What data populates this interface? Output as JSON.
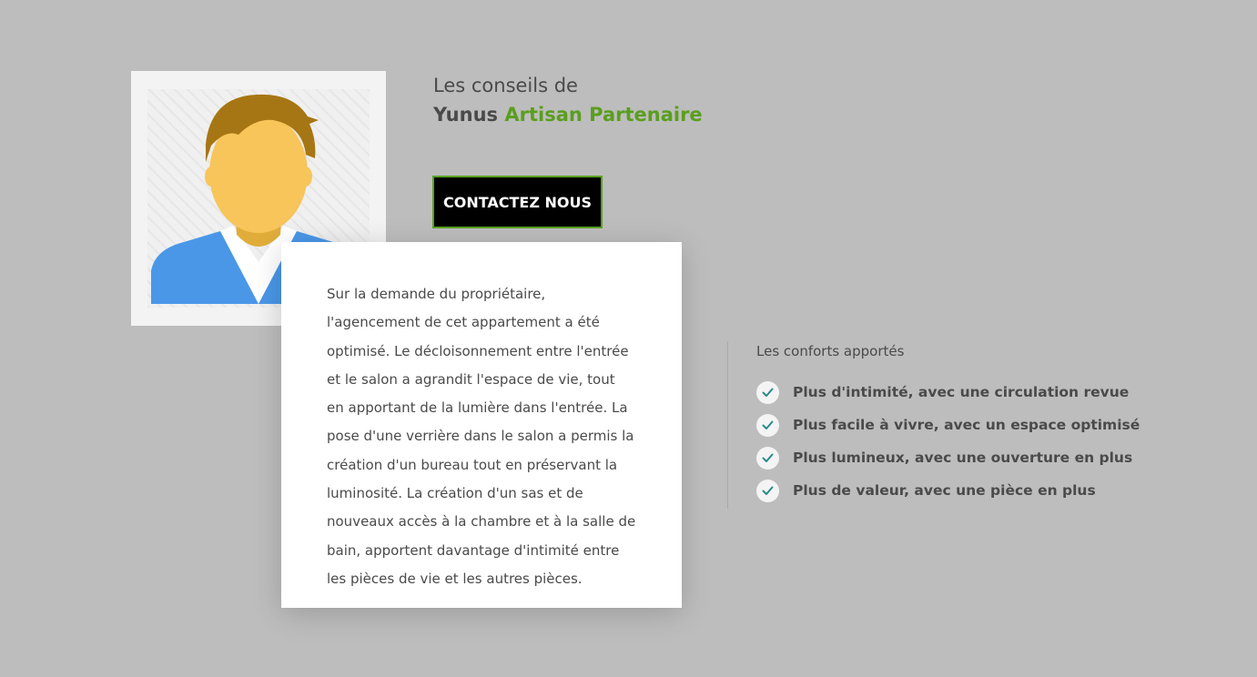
{
  "header": {
    "intro": "Les conseils de",
    "name": "Yunus",
    "role": "Artisan Partenaire"
  },
  "contact_button": {
    "label": "CONTACTEZ NOUS"
  },
  "description": {
    "text": "Sur la demande du propriétaire, l'agencement de cet appartement a été optimisé. Le décloisonnement entre l'entrée et le salon a agrandit l'espace de vie, tout en apportant de la lumière dans l'entrée. La pose d'une verrière dans le salon a permis la création d'un bureau tout en préservant la luminosité. La création d'un sas et de nouveaux accès à la chambre et à la salle de bain, apportent davantage d'intimité entre les pièces de vie et les autres pièces."
  },
  "comforts": {
    "title": "Les conforts apportés",
    "items": [
      {
        "label": "Plus d'intimité, avec une circulation revue",
        "icon": "check-icon"
      },
      {
        "label": "Plus facile à vivre, avec un espace optimisé",
        "icon": "check-icon"
      },
      {
        "label": "Plus lumineux, avec une ouverture en plus",
        "icon": "check-icon"
      },
      {
        "label": "Plus de valeur, avec une pièce en plus",
        "icon": "check-icon"
      }
    ]
  },
  "avatar": {
    "icon": "user-avatar-icon"
  },
  "colors": {
    "page_background": "#bdbdbd",
    "accent_green": "#5a9e1e",
    "button_background": "#000000",
    "check_color": "#2a8a8a",
    "text": "#4a4a4a"
  }
}
